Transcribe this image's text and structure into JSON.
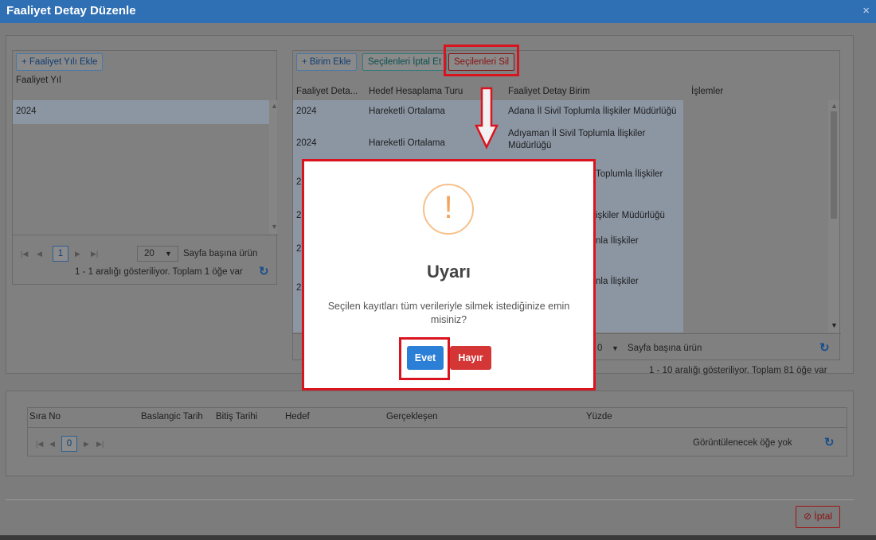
{
  "window": {
    "title": "Faaliyet Detay Düzenle",
    "close_glyph": "×"
  },
  "left_panel": {
    "add_button": "+ Faaliyet Yılı Ekle",
    "column_header": "Faaliyet Yıl",
    "rows": [
      "2024"
    ],
    "pager": {
      "current_page": "1",
      "page_size": "20",
      "page_size_label": "Sayfa başına ürün",
      "info": "1 - 1 aralığı gösteriliyor. Toplam 1 öğe var"
    }
  },
  "right_panel": {
    "toolbar": {
      "add": "+ Birim Ekle",
      "cancel_selected": "Seçilenleri İptal Et",
      "delete_selected": "Seçilenleri Sil"
    },
    "headers": [
      "Faaliyet Deta...",
      "Hedef Hesaplama Turu",
      "Faaliyet Detay Birim",
      "İşlemler"
    ],
    "rows": [
      {
        "year": "2024",
        "type": "Hareketli Ortalama",
        "unit": "Adana İl Sivil Toplumla İlişkiler Müdürlüğü"
      },
      {
        "year": "2024",
        "type": "Hareketli Ortalama",
        "unit": "Adıyaman İl Sivil Toplumla İlişkiler Müdürlüğü"
      },
      {
        "year": "2",
        "type": "",
        "unit": "Toplumla İlişkiler"
      },
      {
        "year": "2",
        "type": "",
        "unit": "işkiler Müdürlüğü"
      },
      {
        "year": "2",
        "type": "",
        "unit": "nla İlişkiler"
      },
      {
        "year": "2",
        "type": "",
        "unit": "nla İlişkiler"
      }
    ],
    "pager": {
      "page_size_partial": "0",
      "page_size_label": "Sayfa başına ürün",
      "info": "1 - 10 aralığı gösteriliyor. Toplam 81 öğe var"
    }
  },
  "bottom_grid": {
    "headers": [
      "Sıra No",
      "Baslangic Tarih",
      "Bitiş Tarihi",
      "Hedef",
      "Gerçekleşen",
      "Yüzde"
    ],
    "current_page": "0",
    "empty_text": "Görüntülenecek öğe yok"
  },
  "footer": {
    "cancel_button": "İptal"
  },
  "modal": {
    "icon": "!",
    "title": "Uyarı",
    "message": "Seçilen kayıtları tüm verileriyle silmek istediğinize emin misiniz?",
    "yes": "Evet",
    "no": "Hayır"
  },
  "colors": {
    "title_bar": "#2f6fb3",
    "highlight_red": "#d9141e",
    "yes_button": "#2c7fd6",
    "no_button": "#d43535",
    "warning_icon": "#f7c08a"
  }
}
